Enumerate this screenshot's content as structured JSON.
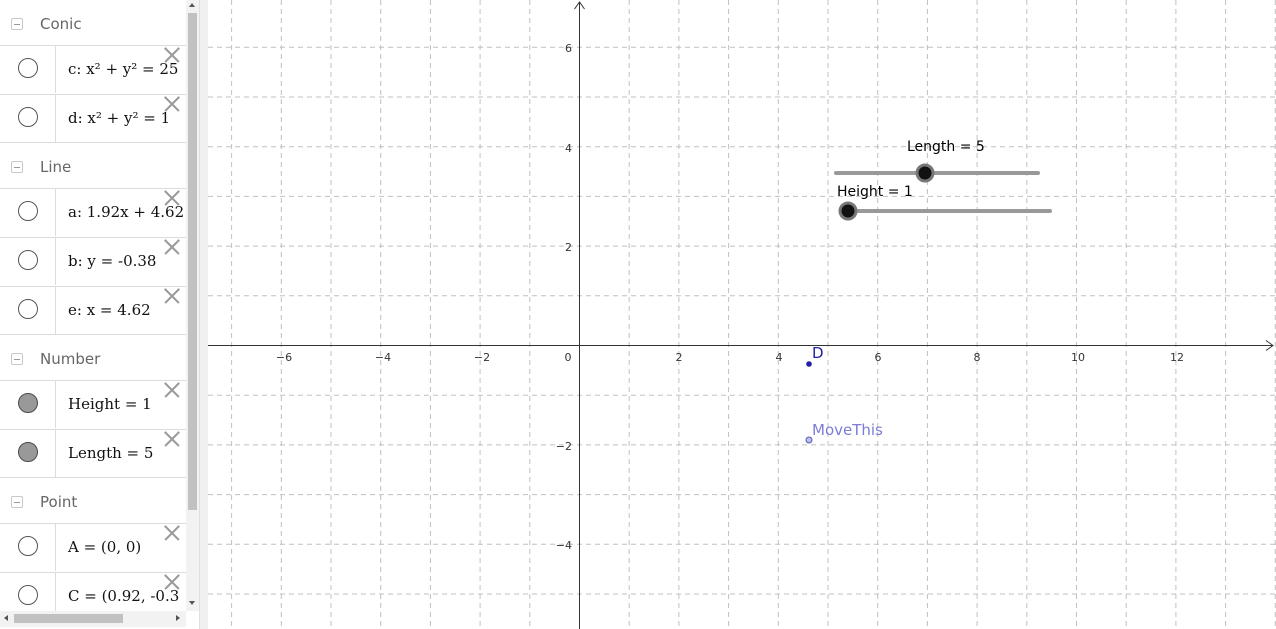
{
  "algebra": {
    "groups": [
      {
        "title": "Conic",
        "items": [
          {
            "text": "c: x² + y² = 25",
            "visible": false
          },
          {
            "text": "d: x² + y² = 1",
            "visible": false
          }
        ]
      },
      {
        "title": "Line",
        "items": [
          {
            "text": "a: 1.92x + 4.62",
            "visible": false
          },
          {
            "text": "b: y = -0.38",
            "visible": false
          },
          {
            "text": "e: x = 4.62",
            "visible": false
          }
        ]
      },
      {
        "title": "Number",
        "items": [
          {
            "text": "Height = 1",
            "visible": true
          },
          {
            "text": "Length = 5",
            "visible": true
          }
        ]
      },
      {
        "title": "Point",
        "items": [
          {
            "text": "A = (0, 0)",
            "visible": false
          },
          {
            "text": "C = (0.92, -0.3",
            "visible": false
          }
        ]
      }
    ]
  },
  "graphics": {
    "x_ticks": [
      "−6",
      "−4",
      "−2",
      "0",
      "2",
      "4",
      "6",
      "8",
      "10",
      "12"
    ],
    "y_ticks": [
      "−4",
      "−2",
      "2",
      "4",
      "6"
    ],
    "sliders": [
      {
        "label": "Length = 5",
        "value": 5,
        "min": 1,
        "max": 10
      },
      {
        "label": "Height = 1",
        "value": 1,
        "min": 1,
        "max": 10
      }
    ],
    "points": [
      {
        "label": "D",
        "x": 4.62,
        "y": -0.38
      },
      {
        "label": "MoveThis",
        "x": 4.62,
        "y": -1.9
      }
    ],
    "colors": {
      "point_d": "#1f1fa8",
      "point_movethis": "#7c7cd6",
      "grid": "#c0c0c0",
      "slider_track": "#999999"
    }
  }
}
